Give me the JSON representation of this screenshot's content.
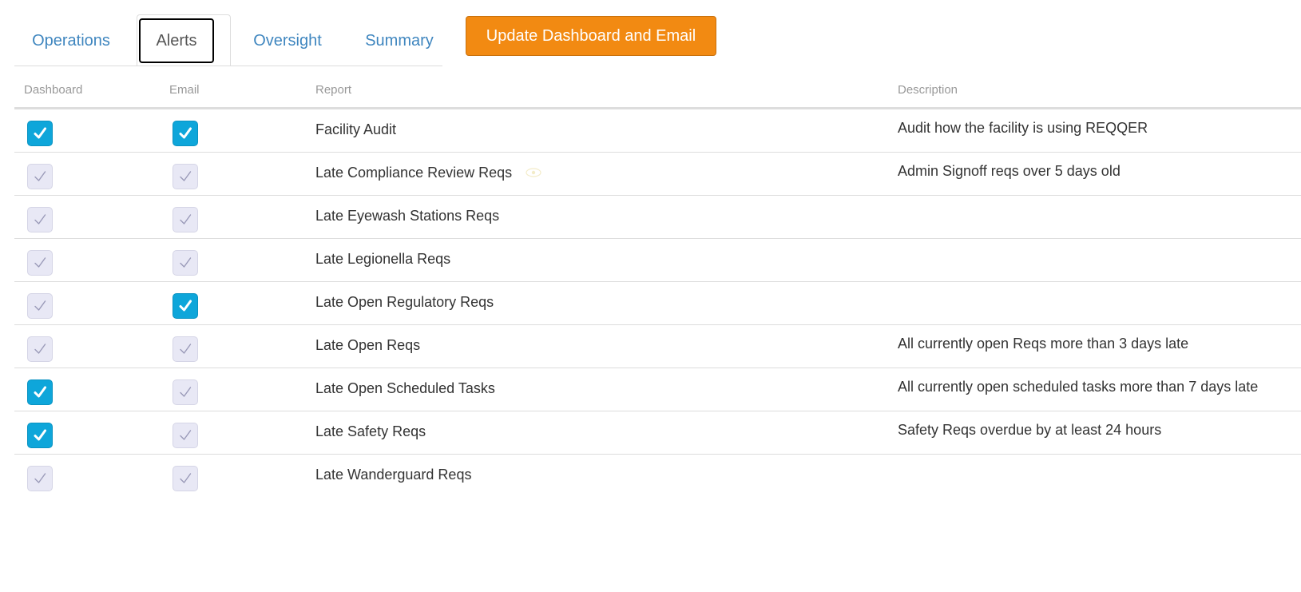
{
  "tabs": [
    {
      "label": "Operations",
      "active": false
    },
    {
      "label": "Alerts",
      "active": true
    },
    {
      "label": "Oversight",
      "active": false
    },
    {
      "label": "Summary",
      "active": false
    }
  ],
  "update_button": {
    "label": "Update Dashboard and Email"
  },
  "colors": {
    "accent": "#0ea6da",
    "button": "#f28a12",
    "tab_link": "#3f86bf"
  },
  "table": {
    "headers": {
      "dashboard": "Dashboard",
      "email": "Email",
      "report": "Report",
      "description": "Description"
    },
    "rows": [
      {
        "dashboard": true,
        "email": true,
        "report": "Facility Audit",
        "description": "Audit how the facility is using REQQER"
      },
      {
        "dashboard": false,
        "email": false,
        "report": "Late Compliance Review Reqs",
        "description": "Admin Signoff reqs over 5 days old",
        "has_eye_icon": true
      },
      {
        "dashboard": false,
        "email": false,
        "report": "Late Eyewash Stations Reqs",
        "description": ""
      },
      {
        "dashboard": false,
        "email": false,
        "report": "Late Legionella Reqs",
        "description": ""
      },
      {
        "dashboard": false,
        "email": true,
        "report": "Late Open Regulatory Reqs",
        "description": ""
      },
      {
        "dashboard": false,
        "email": false,
        "report": "Late Open Reqs",
        "description": "All currently open Reqs more than 3 days late"
      },
      {
        "dashboard": true,
        "email": false,
        "report": "Late Open Scheduled Tasks",
        "description": "All currently open scheduled tasks more than 7 days late"
      },
      {
        "dashboard": true,
        "email": false,
        "report": "Late Safety Reqs",
        "description": "Safety Reqs overdue by at least 24 hours"
      },
      {
        "dashboard": false,
        "email": false,
        "report": "Late Wanderguard Reqs",
        "description": ""
      }
    ]
  }
}
